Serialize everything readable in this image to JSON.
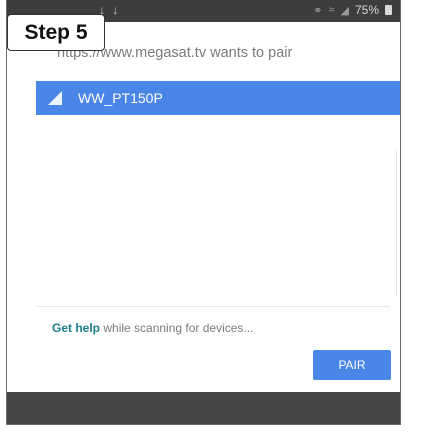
{
  "status_bar": {
    "left_icons": "↓ ↓",
    "battery_text": "75%"
  },
  "step_label": "Step 5",
  "dialog": {
    "title": "https://www.megasat.tv wants to pair",
    "devices": [
      {
        "name": "WW_PT150P"
      }
    ],
    "help_link": "Get help",
    "help_text": " while scanning for devices...",
    "pair_button": "PAIR"
  },
  "colors": {
    "accent": "#4a86e8",
    "link": "#1e7f8f",
    "bottom_bar": "#454545"
  },
  "icons": [
    "link-icon",
    "wifi-icon",
    "signal-icon",
    "battery-icon",
    "device-signal-icon"
  ]
}
